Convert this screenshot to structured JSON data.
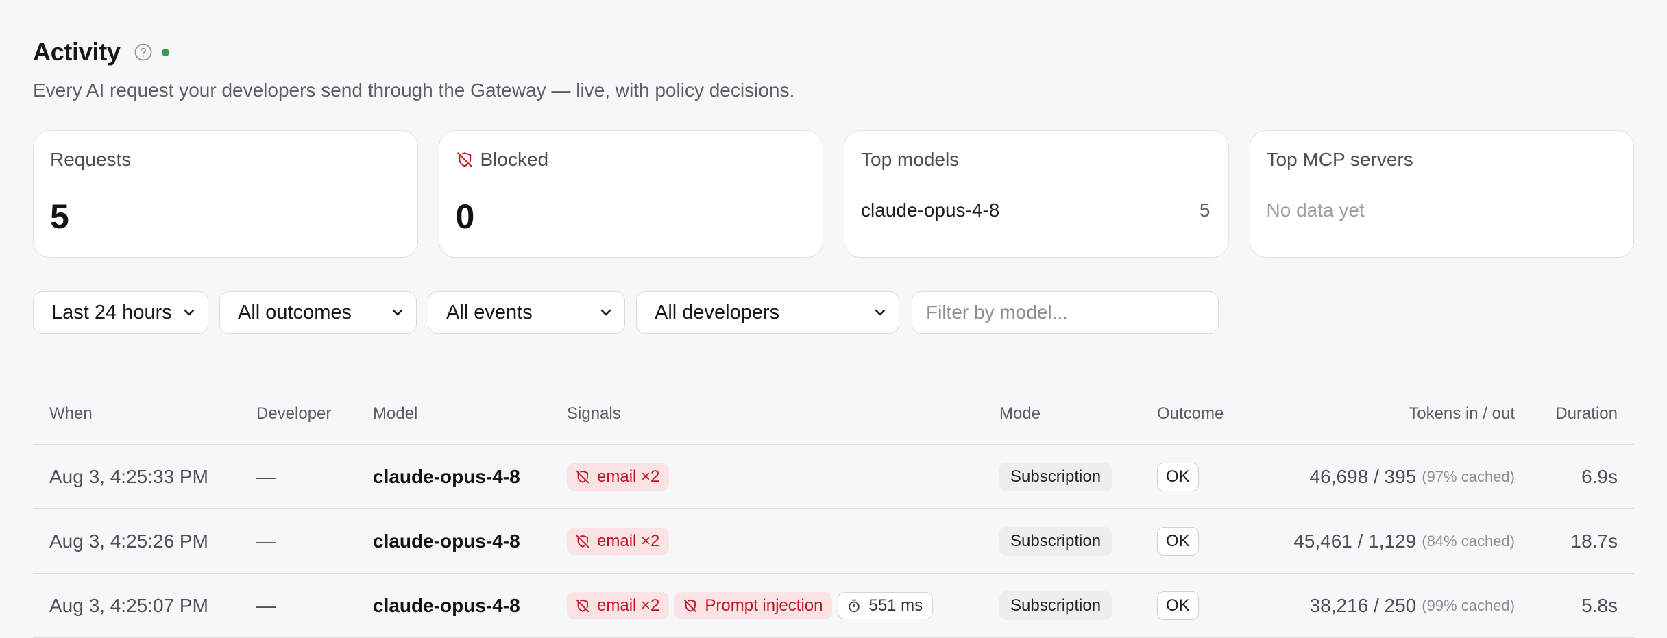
{
  "header": {
    "title": "Activity",
    "subtitle": "Every AI request your developers send through the Gateway — live, with policy decisions.",
    "live_color": "#3a9a4f"
  },
  "cards": {
    "requests": {
      "label": "Requests",
      "value": "5"
    },
    "blocked": {
      "label": "Blocked",
      "value": "0",
      "icon": "shield-off-icon"
    },
    "top_models": {
      "label": "Top models",
      "items": [
        {
          "name": "claude-opus-4-8",
          "count": "5"
        }
      ]
    },
    "top_mcp": {
      "label": "Top MCP servers",
      "empty": "No data yet"
    }
  },
  "filters": {
    "time": "Last 24 hours",
    "outcome": "All outcomes",
    "events": "All events",
    "developers": "All developers",
    "model_placeholder": "Filter by model..."
  },
  "table": {
    "columns": {
      "when": "When",
      "developer": "Developer",
      "model": "Model",
      "signals": "Signals",
      "mode": "Mode",
      "outcome": "Outcome",
      "tokens": "Tokens in / out",
      "duration": "Duration"
    },
    "rows": [
      {
        "when": "Aug 3, 4:25:33 PM",
        "developer": "—",
        "model": "claude-opus-4-8",
        "signal_email": "email ×2",
        "mode": "Subscription",
        "outcome": "OK",
        "tokens": "46,698 / 395",
        "cached": "(97% cached)",
        "duration": "6.9s"
      },
      {
        "when": "Aug 3, 4:25:26 PM",
        "developer": "—",
        "model": "claude-opus-4-8",
        "signal_email": "email ×2",
        "mode": "Subscription",
        "outcome": "OK",
        "tokens": "45,461 / 1,129",
        "cached": "(84% cached)",
        "duration": "18.7s"
      },
      {
        "when": "Aug 3, 4:25:07 PM",
        "developer": "—",
        "model": "claude-opus-4-8",
        "signal_email": "email ×2",
        "signal_injection": "Prompt injection",
        "signal_latency": "551 ms",
        "mode": "Subscription",
        "outcome": "OK",
        "tokens": "38,216 / 250",
        "cached": "(99% cached)",
        "duration": "5.8s"
      }
    ]
  },
  "colors": {
    "signal_red": "#c2121e",
    "signal_red_bg": "#fbe3e5",
    "background": "#f6f7f8"
  }
}
